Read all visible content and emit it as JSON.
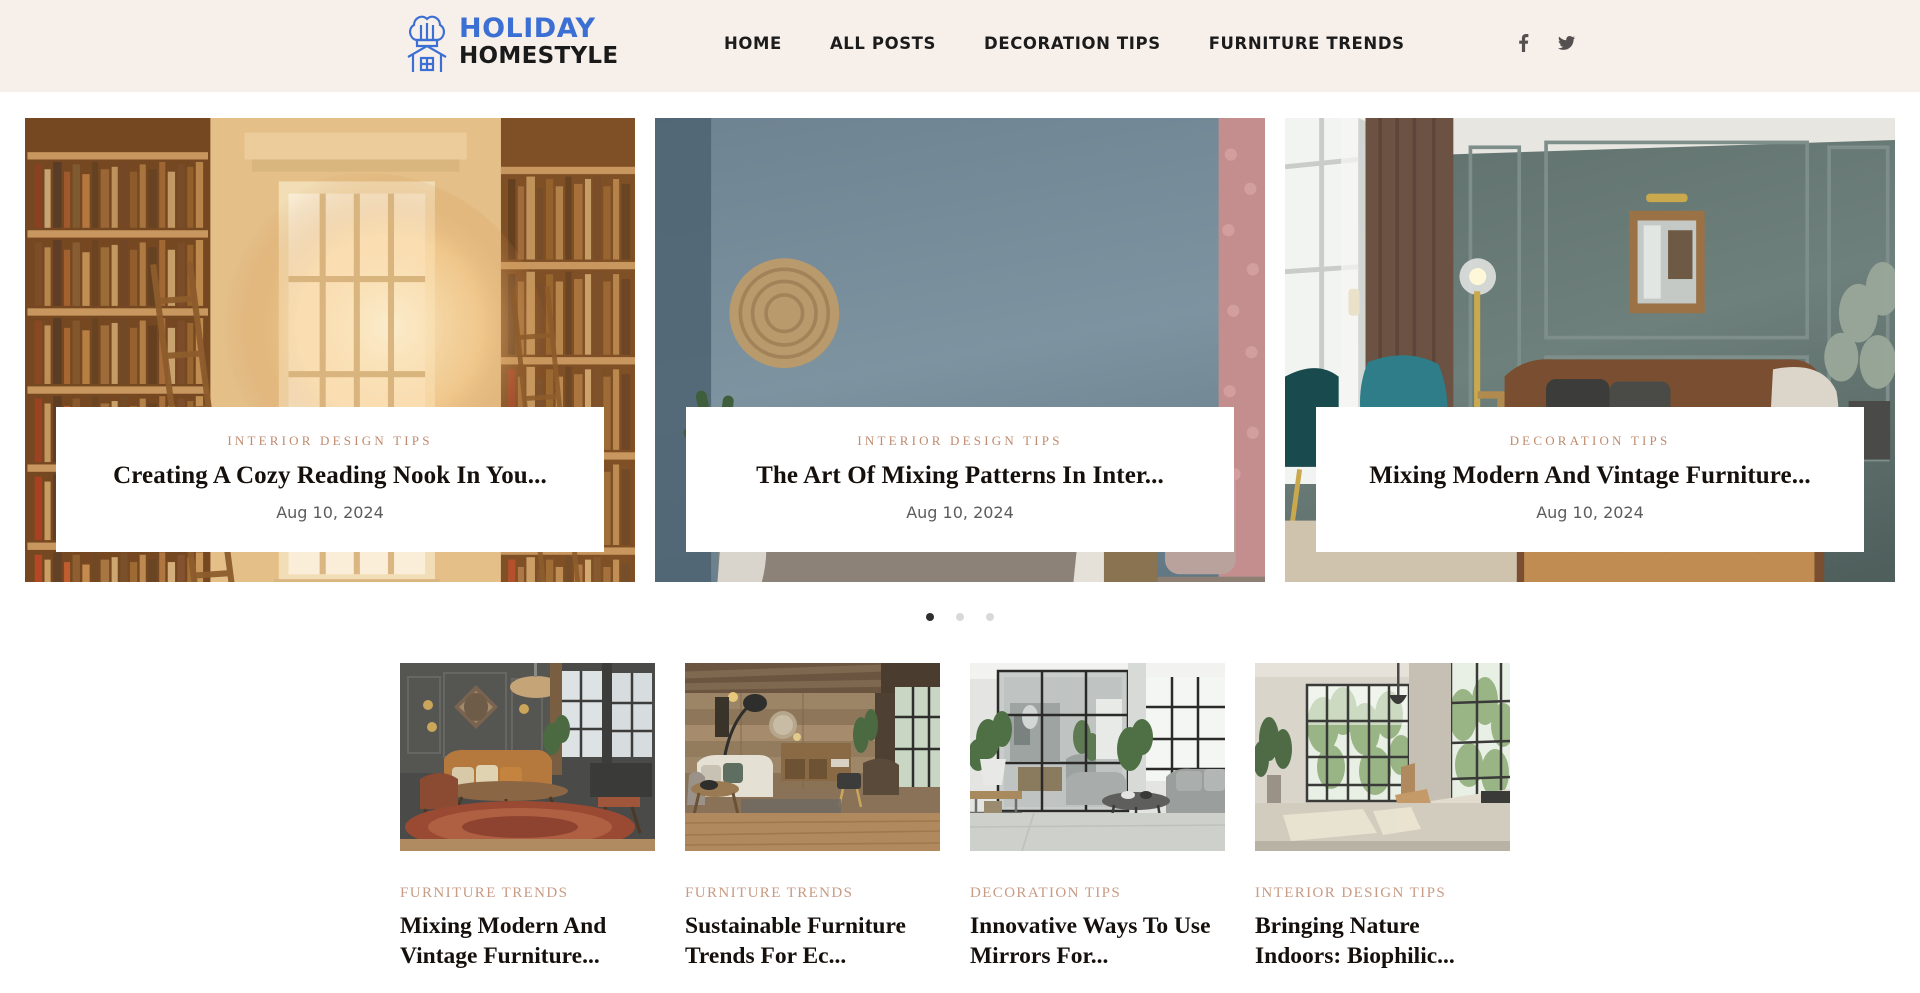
{
  "header": {
    "logo": {
      "icon": "chef-hat-house-icon",
      "line1": "HOLIDAY",
      "line2": "HOMESTYLE",
      "brand_blue": "#3C6FD4",
      "brand_dark": "#1A1A1A"
    },
    "background": "#F7F0EA",
    "nav": [
      {
        "label": "HOME"
      },
      {
        "label": "ALL POSTS"
      },
      {
        "label": "DECORATION TIPS"
      },
      {
        "label": "FURNITURE TRENDS"
      }
    ],
    "social": [
      {
        "name": "facebook-icon"
      },
      {
        "name": "twitter-icon"
      }
    ]
  },
  "hero": {
    "accent_color": "#C08A6E",
    "slides": [
      {
        "category": "INTERIOR DESIGN TIPS",
        "title": "Creating A Cozy Reading Nook In You...",
        "date": "Aug 10, 2024",
        "image_alt": "sunlit-library-reading-nook"
      },
      {
        "category": "INTERIOR DESIGN TIPS",
        "title": "The Art Of Mixing Patterns In Inter...",
        "date": "Aug 10, 2024",
        "image_alt": "blue-wall-patterned-sofa-cushions"
      },
      {
        "category": "DECORATION TIPS",
        "title": "Mixing Modern And Vintage Furniture...",
        "date": "Aug 10, 2024",
        "image_alt": "sage-panelled-room-chesterfield-sofa"
      }
    ],
    "dots": [
      {
        "active": true
      },
      {
        "active": false
      },
      {
        "active": false
      }
    ]
  },
  "posts": {
    "accent_color": "#C89B84",
    "items": [
      {
        "category": "FURNITURE TRENDS",
        "title": "Mixing Modern And Vintage Furniture...",
        "image_alt": "dark-grey-lounge-leather-sofa-rug"
      },
      {
        "category": "FURNITURE TRENDS",
        "title": "Sustainable Furniture Trends For Ec...",
        "image_alt": "rustic-reclaimed-wood-living-room"
      },
      {
        "category": "DECORATION TIPS",
        "title": "Innovative Ways To Use Mirrors For...",
        "image_alt": "mirrored-wall-modern-loft-grey-sofa"
      },
      {
        "category": "INTERIOR DESIGN TIPS",
        "title": "Bringing Nature Indoors: Biophilic...",
        "image_alt": "minimal-room-large-grid-windows-greenery"
      }
    ]
  }
}
